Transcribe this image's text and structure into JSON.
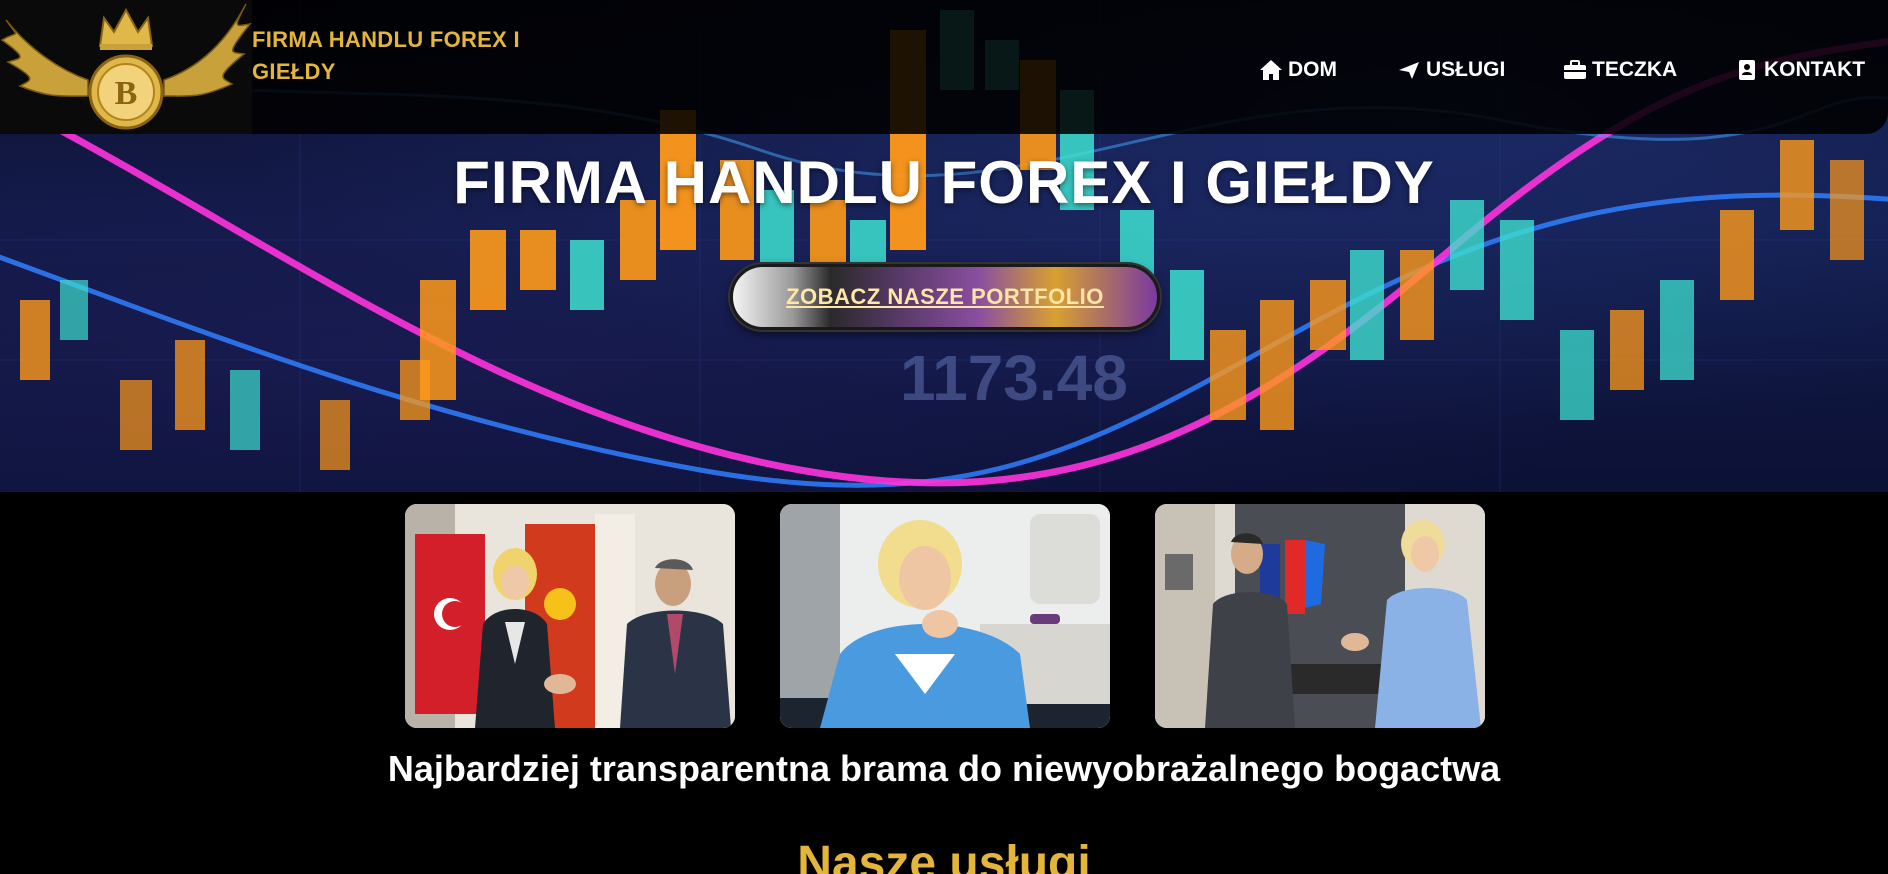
{
  "brand": {
    "name": "FIRMA HANDLU FOREX I GIEŁDY",
    "logo_icon": "bitcoin-winged-crown-logo"
  },
  "nav": {
    "items": [
      {
        "label": "DOM",
        "icon": "home-icon"
      },
      {
        "label": "USŁUGI",
        "icon": "paper-plane-icon"
      },
      {
        "label": "TECZKA",
        "icon": "briefcase-icon"
      },
      {
        "label": "KONTAKT",
        "icon": "address-book-icon"
      }
    ]
  },
  "hero": {
    "title": "FIRMA HANDLU FOREX I GIEŁDY",
    "cta_label": "ZOBACZ NASZE PORTFOLIO",
    "chart_readout": "1173.48"
  },
  "gallery": {
    "images": [
      {
        "alt": "handshake-flags-photo"
      },
      {
        "alt": "woman-blue-jacket-photo"
      },
      {
        "alt": "handshake-office-photo"
      }
    ]
  },
  "tagline": "Najbardziej transparentna brama do niewyobrażalnego bogactwa",
  "services_heading": "Nasze usługi",
  "colors": {
    "gold": "#e3b53a",
    "background": "#000000",
    "accent_purple": "#8a4ea0"
  }
}
